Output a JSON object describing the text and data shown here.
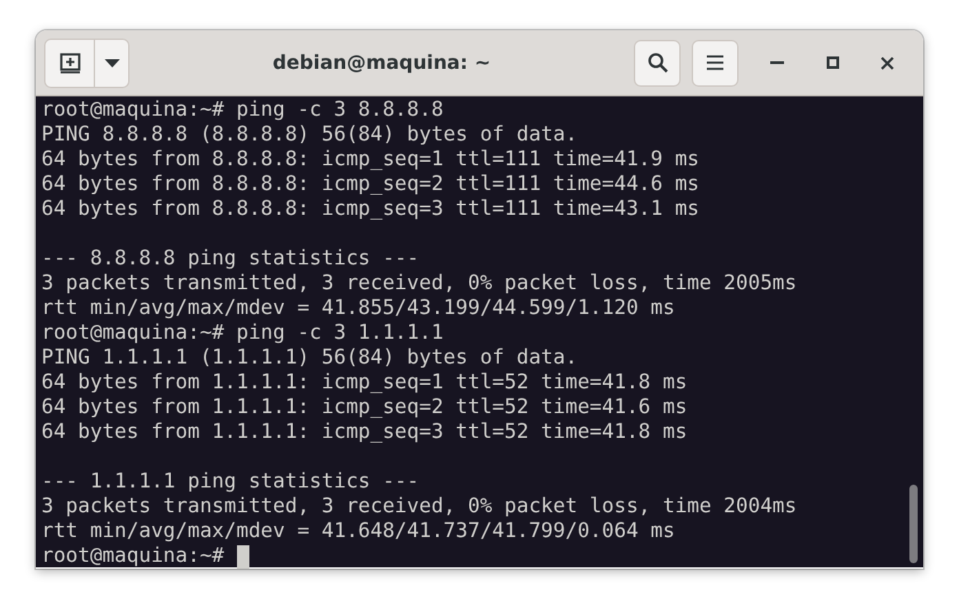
{
  "window": {
    "title": "debian@maquina: ~"
  },
  "terminal": {
    "lines": [
      {
        "kind": "text",
        "text": "root@maquina:~# ping -c 3 8.8.8.8"
      },
      {
        "kind": "text",
        "text": "PING 8.8.8.8 (8.8.8.8) 56(84) bytes of data."
      },
      {
        "kind": "text",
        "text": "64 bytes from 8.8.8.8: icmp_seq=1 ttl=111 time=41.9 ms"
      },
      {
        "kind": "text",
        "text": "64 bytes from 8.8.8.8: icmp_seq=2 ttl=111 time=44.6 ms"
      },
      {
        "kind": "text",
        "text": "64 bytes from 8.8.8.8: icmp_seq=3 ttl=111 time=43.1 ms"
      },
      {
        "kind": "blank"
      },
      {
        "kind": "text",
        "text": "--- 8.8.8.8 ping statistics ---"
      },
      {
        "kind": "text",
        "text": "3 packets transmitted, 3 received, 0% packet loss, time 2005ms"
      },
      {
        "kind": "text",
        "text": "rtt min/avg/max/mdev = 41.855/43.199/44.599/1.120 ms"
      },
      {
        "kind": "text",
        "text": "root@maquina:~# ping -c 3 1.1.1.1"
      },
      {
        "kind": "text",
        "text": "PING 1.1.1.1 (1.1.1.1) 56(84) bytes of data."
      },
      {
        "kind": "text",
        "text": "64 bytes from 1.1.1.1: icmp_seq=1 ttl=52 time=41.8 ms"
      },
      {
        "kind": "text",
        "text": "64 bytes from 1.1.1.1: icmp_seq=2 ttl=52 time=41.6 ms"
      },
      {
        "kind": "text",
        "text": "64 bytes from 1.1.1.1: icmp_seq=3 ttl=52 time=41.8 ms"
      },
      {
        "kind": "blank"
      },
      {
        "kind": "text",
        "text": "--- 1.1.1.1 ping statistics ---"
      },
      {
        "kind": "text",
        "text": "3 packets transmitted, 3 received, 0% packet loss, time 2004ms"
      },
      {
        "kind": "text",
        "text": "rtt min/avg/max/mdev = 41.648/41.737/41.799/0.064 ms"
      },
      {
        "kind": "prompt",
        "text": "root@maquina:~#",
        "cursor": true
      }
    ]
  }
}
